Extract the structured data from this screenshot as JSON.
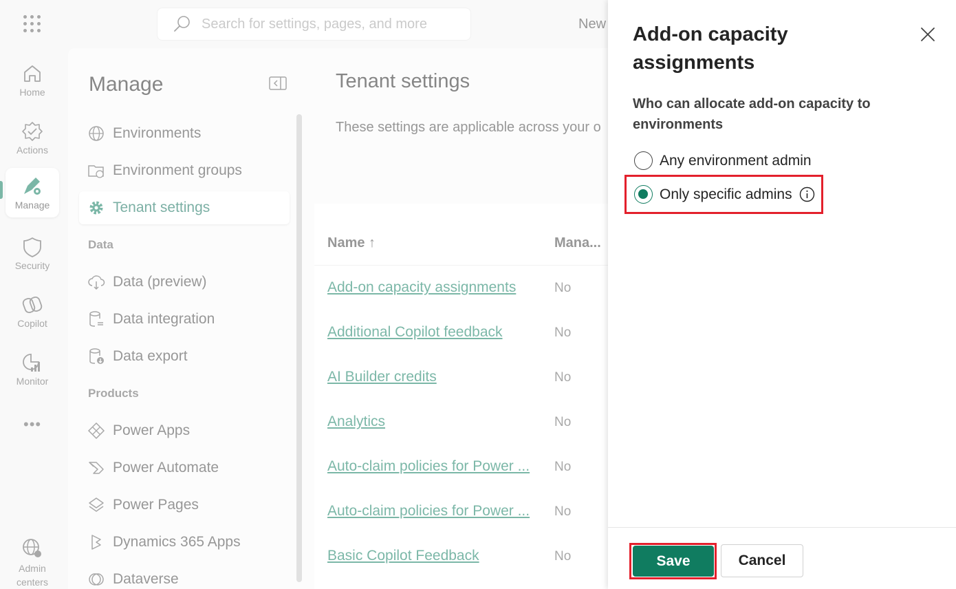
{
  "search": {
    "placeholder": "Search for settings, pages, and more"
  },
  "header": {
    "new_label": "New"
  },
  "rail": {
    "items": [
      {
        "label": "Home",
        "icon": "home-icon"
      },
      {
        "label": "Actions",
        "icon": "actions-icon"
      },
      {
        "label": "Manage",
        "icon": "manage-icon"
      },
      {
        "label": "Security",
        "icon": "shield-icon"
      },
      {
        "label": "Copilot",
        "icon": "copilot-icon"
      },
      {
        "label": "Monitor",
        "icon": "monitor-icon"
      }
    ],
    "more": "•••",
    "admin_centers": "Admin centers"
  },
  "manage": {
    "title": "Manage",
    "items": [
      {
        "label": "Environments",
        "icon": "globe-icon"
      },
      {
        "label": "Environment groups",
        "icon": "folder-globe-icon"
      },
      {
        "label": "Tenant settings",
        "icon": "gear-icon"
      }
    ],
    "section_data": "Data",
    "data_items": [
      {
        "label": "Data (preview)",
        "icon": "cloud-icon"
      },
      {
        "label": "Data integration",
        "icon": "database-link-icon"
      },
      {
        "label": "Data export",
        "icon": "database-export-icon"
      }
    ],
    "section_products": "Products",
    "product_items": [
      {
        "label": "Power Apps",
        "icon": "power-apps-icon"
      },
      {
        "label": "Power Automate",
        "icon": "power-automate-icon"
      },
      {
        "label": "Power Pages",
        "icon": "power-pages-icon"
      },
      {
        "label": "Dynamics 365 Apps",
        "icon": "dynamics-icon"
      },
      {
        "label": "Dataverse",
        "icon": "dataverse-icon"
      }
    ]
  },
  "main": {
    "title": "Tenant settings",
    "description": "These settings are applicable across your o",
    "columns": {
      "name": "Name ↑",
      "managed": "Mana..."
    },
    "rows": [
      {
        "name": "Add-on capacity assignments",
        "value": "No"
      },
      {
        "name": "Additional Copilot feedback",
        "value": "No"
      },
      {
        "name": "AI Builder credits",
        "value": "No"
      },
      {
        "name": "Analytics",
        "value": "No"
      },
      {
        "name": "Auto-claim policies for Power ...",
        "value": "No"
      },
      {
        "name": "Auto-claim policies for Power ...",
        "value": "No"
      },
      {
        "name": "Basic Copilot Feedback",
        "value": "No"
      }
    ]
  },
  "panel": {
    "title": "Add-on capacity assignments",
    "question": "Who can allocate add-on capacity to environments",
    "options": [
      {
        "label": "Any environment admin",
        "selected": false
      },
      {
        "label": "Only specific admins",
        "selected": true
      }
    ],
    "save": "Save",
    "cancel": "Cancel"
  },
  "colors": {
    "accent": "#107c60",
    "highlight": "#e3202c"
  }
}
